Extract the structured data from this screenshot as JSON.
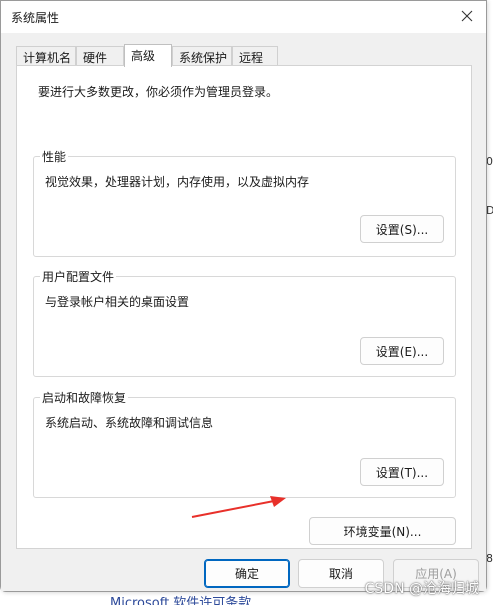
{
  "window": {
    "title": "系统属性"
  },
  "tabs": [
    {
      "label": "计算机名"
    },
    {
      "label": "硬件"
    },
    {
      "label": "高级"
    },
    {
      "label": "系统保护"
    },
    {
      "label": "远程"
    }
  ],
  "active_tab": "高级",
  "panel": {
    "notice": "要进行大多数更改，你必须作为管理员登录。",
    "performance": {
      "title": "性能",
      "description": "视觉效果，处理器计划，内存使用，以及虚拟内存",
      "button": "设置(S)..."
    },
    "user_profiles": {
      "title": "用户配置文件",
      "description": "与登录帐户相关的桌面设置",
      "button": "设置(E)..."
    },
    "startup_recovery": {
      "title": "启动和故障恢复",
      "description": "系统启动、系统故障和调试信息",
      "button": "设置(T)..."
    },
    "env_button": "环境变量(N)..."
  },
  "footer": {
    "ok": "确定",
    "cancel": "取消",
    "apply": "应用(A)"
  },
  "overlay": {
    "watermark": "CSDN @沧海归城",
    "background_text": "Microsoft 软件许可条款",
    "right_edge_chars": [
      "0",
      "D",
      "8"
    ]
  },
  "colors": {
    "primary_border": "#0067c0",
    "arrow": "#e8302a"
  }
}
